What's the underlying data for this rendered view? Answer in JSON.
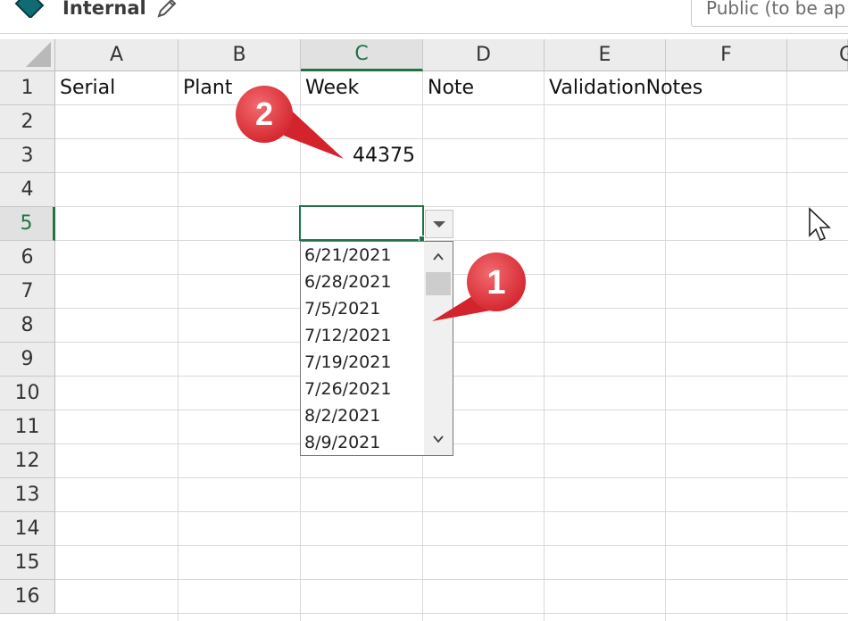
{
  "topbar": {
    "sensitivity_label": "Internal",
    "sensitivity_box_text": "Public (to be ap",
    "icons": [
      "sensitivity-tag-icon",
      "edit-pencil-icon"
    ]
  },
  "columns": [
    "A",
    "B",
    "C",
    "D",
    "E",
    "F",
    "G"
  ],
  "active_column": "C",
  "rows": [
    "1",
    "2",
    "3",
    "4",
    "5",
    "6",
    "7",
    "8",
    "9",
    "10",
    "11",
    "12",
    "13",
    "14",
    "15",
    "16"
  ],
  "active_row": "5",
  "cells": {
    "A1": "Serial",
    "B1": "Plant",
    "C1": "Week",
    "D1": "Note",
    "E1": "ValidationNotes",
    "C3": "44375"
  },
  "dropdown": {
    "items": [
      "6/21/2021",
      "6/28/2021",
      "7/5/2021",
      "7/12/2021",
      "7/19/2021",
      "7/26/2021",
      "8/2/2021",
      "8/9/2021"
    ]
  },
  "callouts": {
    "one": "1",
    "two": "2",
    "color": "#e8323c"
  },
  "colors": {
    "accent": "#217346"
  }
}
